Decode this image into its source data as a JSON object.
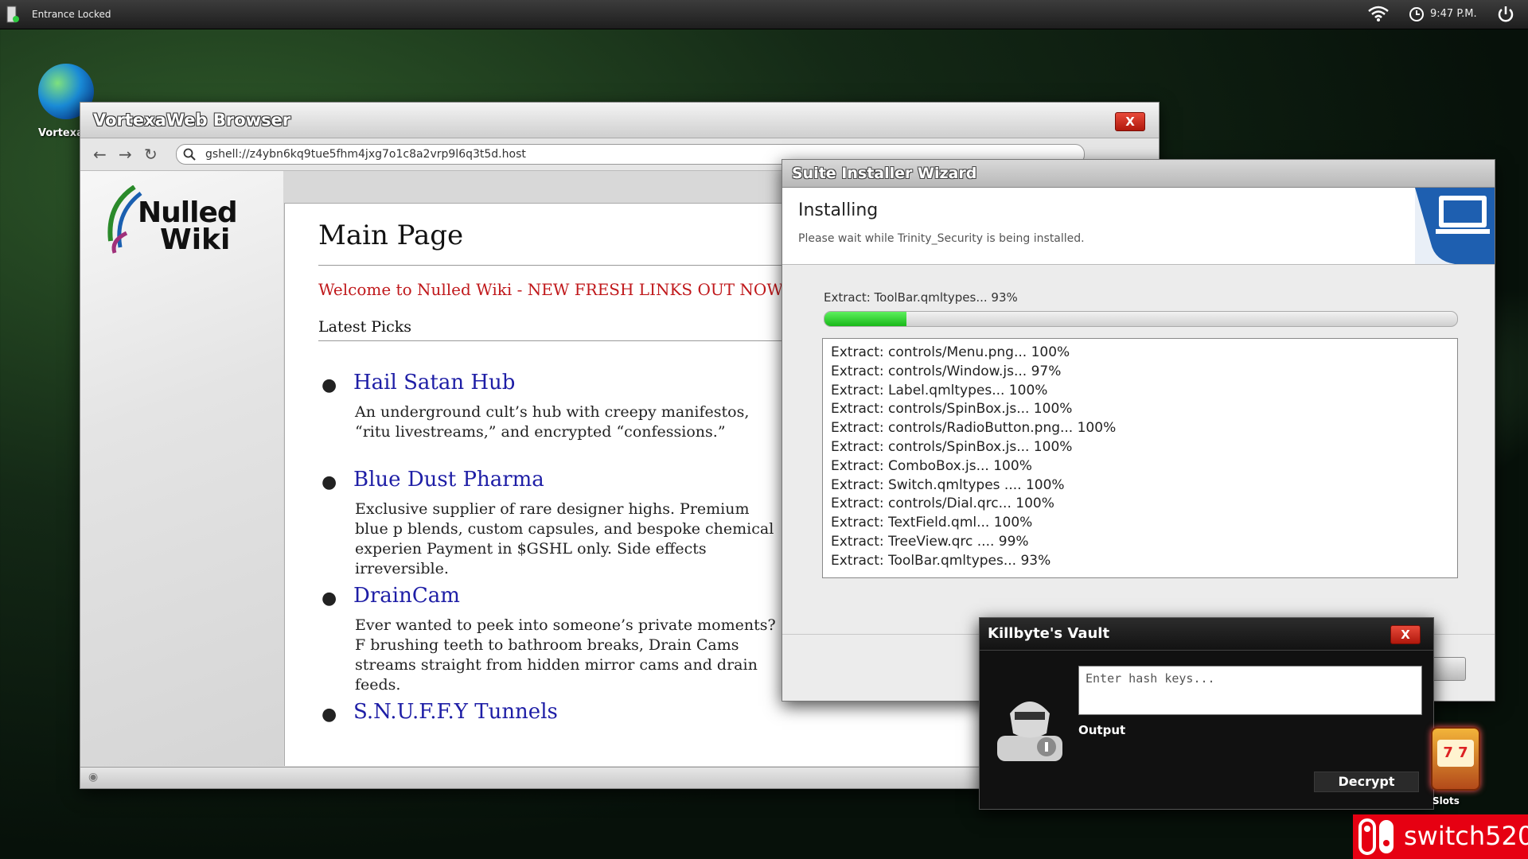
{
  "topbar": {
    "status": "Entrance Locked",
    "time": "9:47 P.M."
  },
  "desktop": {
    "browser_icon_label": "Vortexa",
    "slots_label": "Slots"
  },
  "browser": {
    "title": "VortexaWeb Browser",
    "close_label": "X",
    "url": "gshell://z4ybn6kq9tue5fhm4jxg7o1c8a2vrp9l6q3t5d.host",
    "logo_line1": "Nulled",
    "logo_line2": "Wiki",
    "page_title": "Main Page",
    "welcome": "Welcome to Nulled Wiki - NEW FRESH LINKS OUT NOW!",
    "latest_heading": "Latest Picks",
    "picks": [
      {
        "title": "Hail Satan Hub",
        "desc": "An underground cult’s hub with creepy manifestos, “ritu livestreams,” and encrypted “confessions.”"
      },
      {
        "title": "Blue Dust Pharma",
        "desc": "Exclusive supplier of rare designer highs. Premium blue p blends, custom capsules, and bespoke chemical experien Payment in $GSHL only. Side effects irreversible."
      },
      {
        "title": "DrainCam",
        "desc": "Ever wanted to peek into someone’s private moments? F brushing teeth to bathroom breaks, Drain Cams streams straight from hidden mirror cams and drain feeds."
      },
      {
        "title": "S.N.U.F.F.Y Tunnels",
        "desc": ""
      }
    ]
  },
  "installer": {
    "title": "Suite Installer Wizard",
    "heading": "Installing",
    "subtitle": "Please wait while Trinity_Security is being installed.",
    "progress_label": "Extract: ToolBar.qmltypes... 93%",
    "progress_fraction": 0.13,
    "log": [
      "Extract: controls/Menu.png... 100%",
      "Extract: controls/Window.js... 97%",
      "Extract: Label.qmltypes... 100%",
      "Extract: controls/SpinBox.js... 100%",
      "Extract: controls/RadioButton.png... 100%",
      "Extract: controls/SpinBox.js... 100%",
      "Extract: ComboBox.js... 100%",
      "Extract: Switch.qmltypes .... 100%",
      "Extract: controls/Dial.qrc... 100%",
      "Extract: TextField.qml... 100%",
      "Extract: TreeView.qrc .... 99%",
      "Extract: ToolBar.qmltypes... 93%"
    ]
  },
  "vault": {
    "title": "Killbyte's Vault",
    "close_label": "X",
    "input_placeholder": "Enter hash keys...",
    "output_label": "Output",
    "decrypt_label": "Decrypt"
  },
  "watermark": {
    "text": "switch520"
  }
}
